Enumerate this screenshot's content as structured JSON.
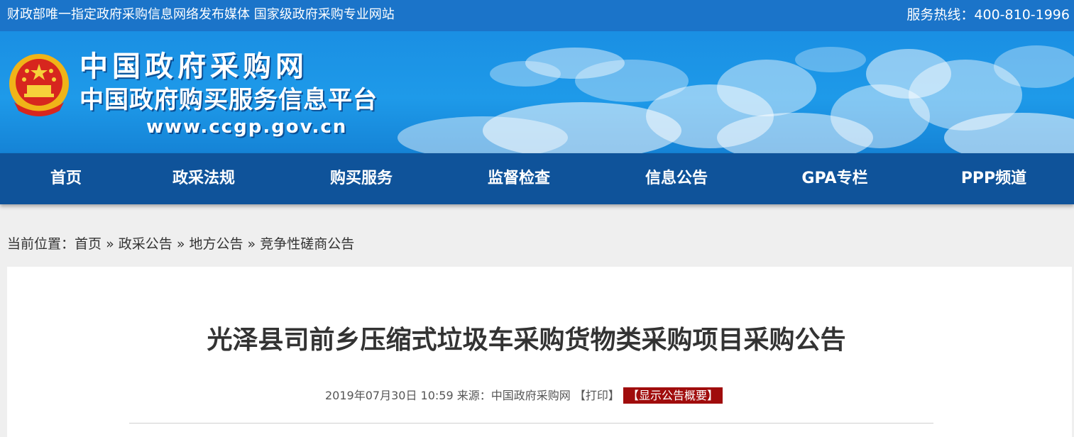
{
  "topbar": {
    "slogan": "财政部唯一指定政府采购信息网络发布媒体 国家级政府采购专业网站",
    "hotline": "服务热线：400-810-1996"
  },
  "banner": {
    "title": "中国政府采购网",
    "subtitle": "中国政府购买服务信息平台",
    "url": "www.ccgp.gov.cn",
    "emblem_icon": "national-emblem-icon"
  },
  "nav": {
    "items": [
      {
        "label": "首页"
      },
      {
        "label": "政采法规"
      },
      {
        "label": "购买服务"
      },
      {
        "label": "监督检查"
      },
      {
        "label": "信息公告"
      },
      {
        "label": "GPA专栏"
      },
      {
        "label": "PPP频道"
      }
    ]
  },
  "breadcrumb": {
    "prefix": "当前位置：",
    "items": [
      {
        "label": "首页"
      },
      {
        "label": "政采公告"
      },
      {
        "label": "地方公告"
      },
      {
        "label": "竞争性磋商公告"
      }
    ],
    "sep": "»"
  },
  "article": {
    "title": "光泽县司前乡压缩式垃圾车采购货物类采购项目采购公告",
    "date": "2019年07月30日 10:59",
    "source": "来源：中国政府采购网",
    "print": "【打印】",
    "summary": "【显示公告概要】"
  },
  "colors": {
    "topbar": "#1b74c9",
    "nav": "#0f539a",
    "summary_bg": "#a00c0c"
  }
}
